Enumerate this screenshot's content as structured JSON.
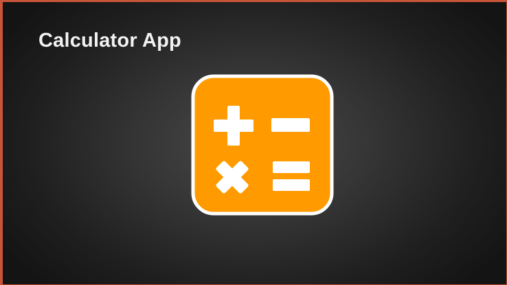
{
  "slide": {
    "title": "Calculator App"
  },
  "icon": {
    "name": "calculator-icon",
    "symbols": [
      "plus-icon",
      "minus-icon",
      "multiply-icon",
      "equals-icon"
    ],
    "background_color": "#ff9a00",
    "outline_color": "#ffffff",
    "glyph_color": "#ffffff"
  },
  "colors": {
    "background_center": "#4a4a4a",
    "background_edge": "#141414",
    "border": "#c8553a",
    "title_text": "#f2f2f2"
  }
}
